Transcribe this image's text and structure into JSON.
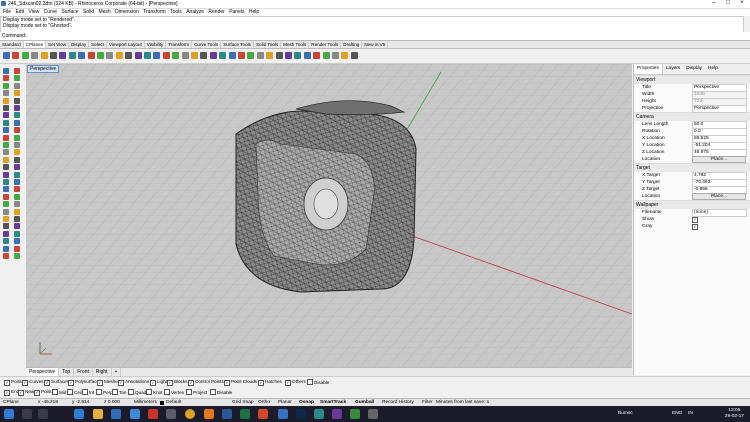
{
  "window": {
    "title": "246_Sdscan02.3dm (324 KB) - Rhinoceros Corporate (64-bit) - [Perspective]"
  },
  "menu": [
    "File",
    "Edit",
    "View",
    "Curve",
    "Surface",
    "Solid",
    "Mesh",
    "Dimension",
    "Transform",
    "Tools",
    "Analyze",
    "Render",
    "Panels",
    "Help"
  ],
  "history": [
    "Display mode set to \"Rendered\".",
    "Display mode set to \"Ghosted\"."
  ],
  "command": {
    "label": "Command:"
  },
  "toolbar_tabs": [
    "Standard",
    "CPlanes",
    "Set View",
    "Display",
    "Select",
    "Viewport Layout",
    "Visibility",
    "Transform",
    "Curve Tools",
    "Surface Tools",
    "Solid Tools",
    "Mesh Tools",
    "Render Tools",
    "Drafting",
    "New in V5"
  ],
  "toolbar_active": 1,
  "viewport": {
    "label": "Perspective"
  },
  "viewport_tabs": [
    "Perspective",
    "Top",
    "Front",
    "Right",
    "+"
  ],
  "panel": {
    "tabs": [
      "Properties",
      "Layers",
      "Display",
      "Help"
    ],
    "sections": {
      "viewport": "Viewport",
      "camera": "Camera",
      "target": "Target",
      "wallpaper": "Wallpaper"
    },
    "viewport_rows": [
      {
        "k": "Title",
        "v": "Perspective"
      },
      {
        "k": "Width",
        "v": "1040",
        "dis": true
      },
      {
        "k": "Height",
        "v": "722",
        "dis": true
      },
      {
        "k": "Projection",
        "v": "Perspective"
      }
    ],
    "camera_rows": [
      {
        "k": "Lens Length",
        "v": "50.0"
      },
      {
        "k": "Rotation",
        "v": "0.0"
      },
      {
        "k": "X Location",
        "v": "69.525"
      },
      {
        "k": "Y Location",
        "v": "-51.204"
      },
      {
        "k": "Z Location",
        "v": "46.975"
      },
      {
        "k": "Location",
        "btn": "Place..."
      }
    ],
    "target_rows": [
      {
        "k": "X Target",
        "v": "4.782"
      },
      {
        "k": "Y Target",
        "v": "-70.463"
      },
      {
        "k": "Z Target",
        "v": "-0.956"
      },
      {
        "k": "Location",
        "btn": "Place..."
      }
    ],
    "wallpaper_rows": [
      {
        "k": "Filename",
        "v": "(none)"
      },
      {
        "k": "Show",
        "chk": true
      },
      {
        "k": "Gray",
        "chk": true
      }
    ]
  },
  "selection_filter": [
    "Points",
    "Curves",
    "Surfaces",
    "Polysurfaces",
    "Meshes",
    "Annotations",
    "Lights",
    "Blocks",
    "Control Points",
    "Point Clouds",
    "Hatches",
    "Others",
    "Disable"
  ],
  "osnaps": [
    "End",
    "Near",
    "Point",
    "Mid",
    "Cen",
    "Int",
    "Perp",
    "Tan",
    "Quad",
    "Knot",
    "Vertex",
    "Project",
    "Disable"
  ],
  "status": {
    "cplane": "CPlane",
    "x": "x -46.218",
    "y": "y -2.514",
    "z": "z 0.000",
    "units": "Millimeters",
    "layer": "Default",
    "items": [
      "Grid Snap",
      "Ortho",
      "Planar",
      "Osnap",
      "SmartTrack",
      "Gumball",
      "Record History",
      "Filter"
    ],
    "message": "Minutes from last save: 1"
  },
  "taskbar": {
    "lang": "ENG",
    "region": "IN",
    "weather": "Bumsc",
    "time": "13:05",
    "date": "29-02-17"
  },
  "colors": {
    "viewport_bg": "#c8c8c8",
    "grid": "#b4b4b4",
    "mesh": "#262626",
    "taskbar": "#1b1b2b"
  }
}
